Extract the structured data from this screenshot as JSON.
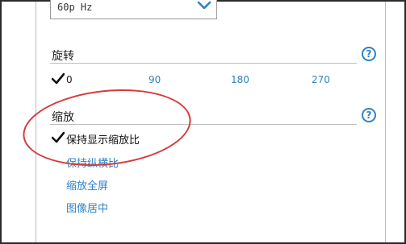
{
  "refresh": {
    "value": "60p Hz"
  },
  "rotation": {
    "title": "旋转",
    "options": [
      {
        "label": "0",
        "selected": true
      },
      {
        "label": "90",
        "selected": false
      },
      {
        "label": "180",
        "selected": false
      },
      {
        "label": "270",
        "selected": false
      }
    ]
  },
  "scaling": {
    "title": "缩放",
    "options": [
      {
        "label": "保持显示缩放比",
        "selected": true
      },
      {
        "label": "保持纵横比",
        "selected": false
      },
      {
        "label": "缩放全屏",
        "selected": false
      },
      {
        "label": "图像居中",
        "selected": false
      }
    ]
  },
  "help": {
    "glyph": "?"
  },
  "colors": {
    "accent": "#2f82c6",
    "highlight": "#d73a3a"
  },
  "icons": {
    "dropdown": "chevron-down-icon",
    "check": "checkmark-icon",
    "help": "help-icon"
  }
}
